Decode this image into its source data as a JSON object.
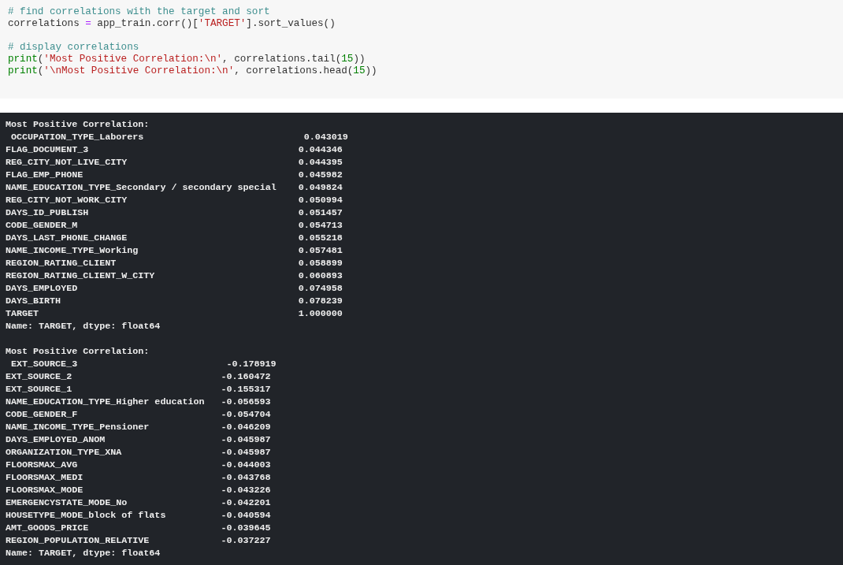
{
  "code_cell": {
    "paragraphs": [
      [
        [
          {
            "kind": "comment",
            "text": "# find correlations with the target and sort"
          }
        ],
        [
          {
            "kind": "plain",
            "text": "correlations "
          },
          {
            "kind": "operator",
            "text": "="
          },
          {
            "kind": "plain",
            "text": " app_train.corr()["
          },
          {
            "kind": "string",
            "text": "'TARGET'"
          },
          {
            "kind": "plain",
            "text": "].sort_values()"
          }
        ]
      ],
      [
        [
          {
            "kind": "comment",
            "text": "# display correlations"
          }
        ],
        [
          {
            "kind": "builtin",
            "text": "print"
          },
          {
            "kind": "plain",
            "text": "("
          },
          {
            "kind": "string",
            "text": "'Most Positive Correlation:\\n'"
          },
          {
            "kind": "plain",
            "text": ", correlations.tail("
          },
          {
            "kind": "number",
            "text": "15"
          },
          {
            "kind": "plain",
            "text": "))"
          }
        ],
        [
          {
            "kind": "builtin",
            "text": "print"
          },
          {
            "kind": "plain",
            "text": "("
          },
          {
            "kind": "string",
            "text": "'\\nMost Positive Correlation:\\n'"
          },
          {
            "kind": "plain",
            "text": ", correlations.head("
          },
          {
            "kind": "number",
            "text": "15"
          },
          {
            "kind": "plain",
            "text": "))"
          }
        ]
      ]
    ]
  },
  "output": {
    "blocks": [
      {
        "heading": "Most Positive Correlation:",
        "rows": [
          {
            "name": "OCCUPATION_TYPE_Laborers",
            "value": "0.043019"
          },
          {
            "name": "FLAG_DOCUMENT_3",
            "value": "0.044346"
          },
          {
            "name": "REG_CITY_NOT_LIVE_CITY",
            "value": "0.044395"
          },
          {
            "name": "FLAG_EMP_PHONE",
            "value": "0.045982"
          },
          {
            "name": "NAME_EDUCATION_TYPE_Secondary / secondary special",
            "value": "0.049824"
          },
          {
            "name": "REG_CITY_NOT_WORK_CITY",
            "value": "0.050994"
          },
          {
            "name": "DAYS_ID_PUBLISH",
            "value": "0.051457"
          },
          {
            "name": "CODE_GENDER_M",
            "value": "0.054713"
          },
          {
            "name": "DAYS_LAST_PHONE_CHANGE",
            "value": "0.055218"
          },
          {
            "name": "NAME_INCOME_TYPE_Working",
            "value": "0.057481"
          },
          {
            "name": "REGION_RATING_CLIENT",
            "value": "0.058899"
          },
          {
            "name": "REGION_RATING_CLIENT_W_CITY",
            "value": "0.060893"
          },
          {
            "name": "DAYS_EMPLOYED",
            "value": "0.074958"
          },
          {
            "name": "DAYS_BIRTH",
            "value": "0.078239"
          },
          {
            "name": "TARGET",
            "value": "1.000000"
          }
        ],
        "footer": "Name: TARGET, dtype: float64"
      },
      {
        "heading": "Most Positive Correlation:",
        "rows": [
          {
            "name": "EXT_SOURCE_3",
            "value": "-0.178919"
          },
          {
            "name": "EXT_SOURCE_2",
            "value": "-0.160472"
          },
          {
            "name": "EXT_SOURCE_1",
            "value": "-0.155317"
          },
          {
            "name": "NAME_EDUCATION_TYPE_Higher education",
            "value": "-0.056593"
          },
          {
            "name": "CODE_GENDER_F",
            "value": "-0.054704"
          },
          {
            "name": "NAME_INCOME_TYPE_Pensioner",
            "value": "-0.046209"
          },
          {
            "name": "DAYS_EMPLOYED_ANOM",
            "value": "-0.045987"
          },
          {
            "name": "ORGANIZATION_TYPE_XNA",
            "value": "-0.045987"
          },
          {
            "name": "FLOORSMAX_AVG",
            "value": "-0.044003"
          },
          {
            "name": "FLOORSMAX_MEDI",
            "value": "-0.043768"
          },
          {
            "name": "FLOORSMAX_MODE",
            "value": "-0.043226"
          },
          {
            "name": "EMERGENCYSTATE_MODE_No",
            "value": "-0.042201"
          },
          {
            "name": "HOUSETYPE_MODE_block of flats",
            "value": "-0.040594"
          },
          {
            "name": "AMT_GOODS_PRICE",
            "value": "-0.039645"
          },
          {
            "name": "REGION_POPULATION_RELATIVE",
            "value": "-0.037227"
          }
        ],
        "footer": "Name: TARGET, dtype: float64"
      }
    ]
  }
}
